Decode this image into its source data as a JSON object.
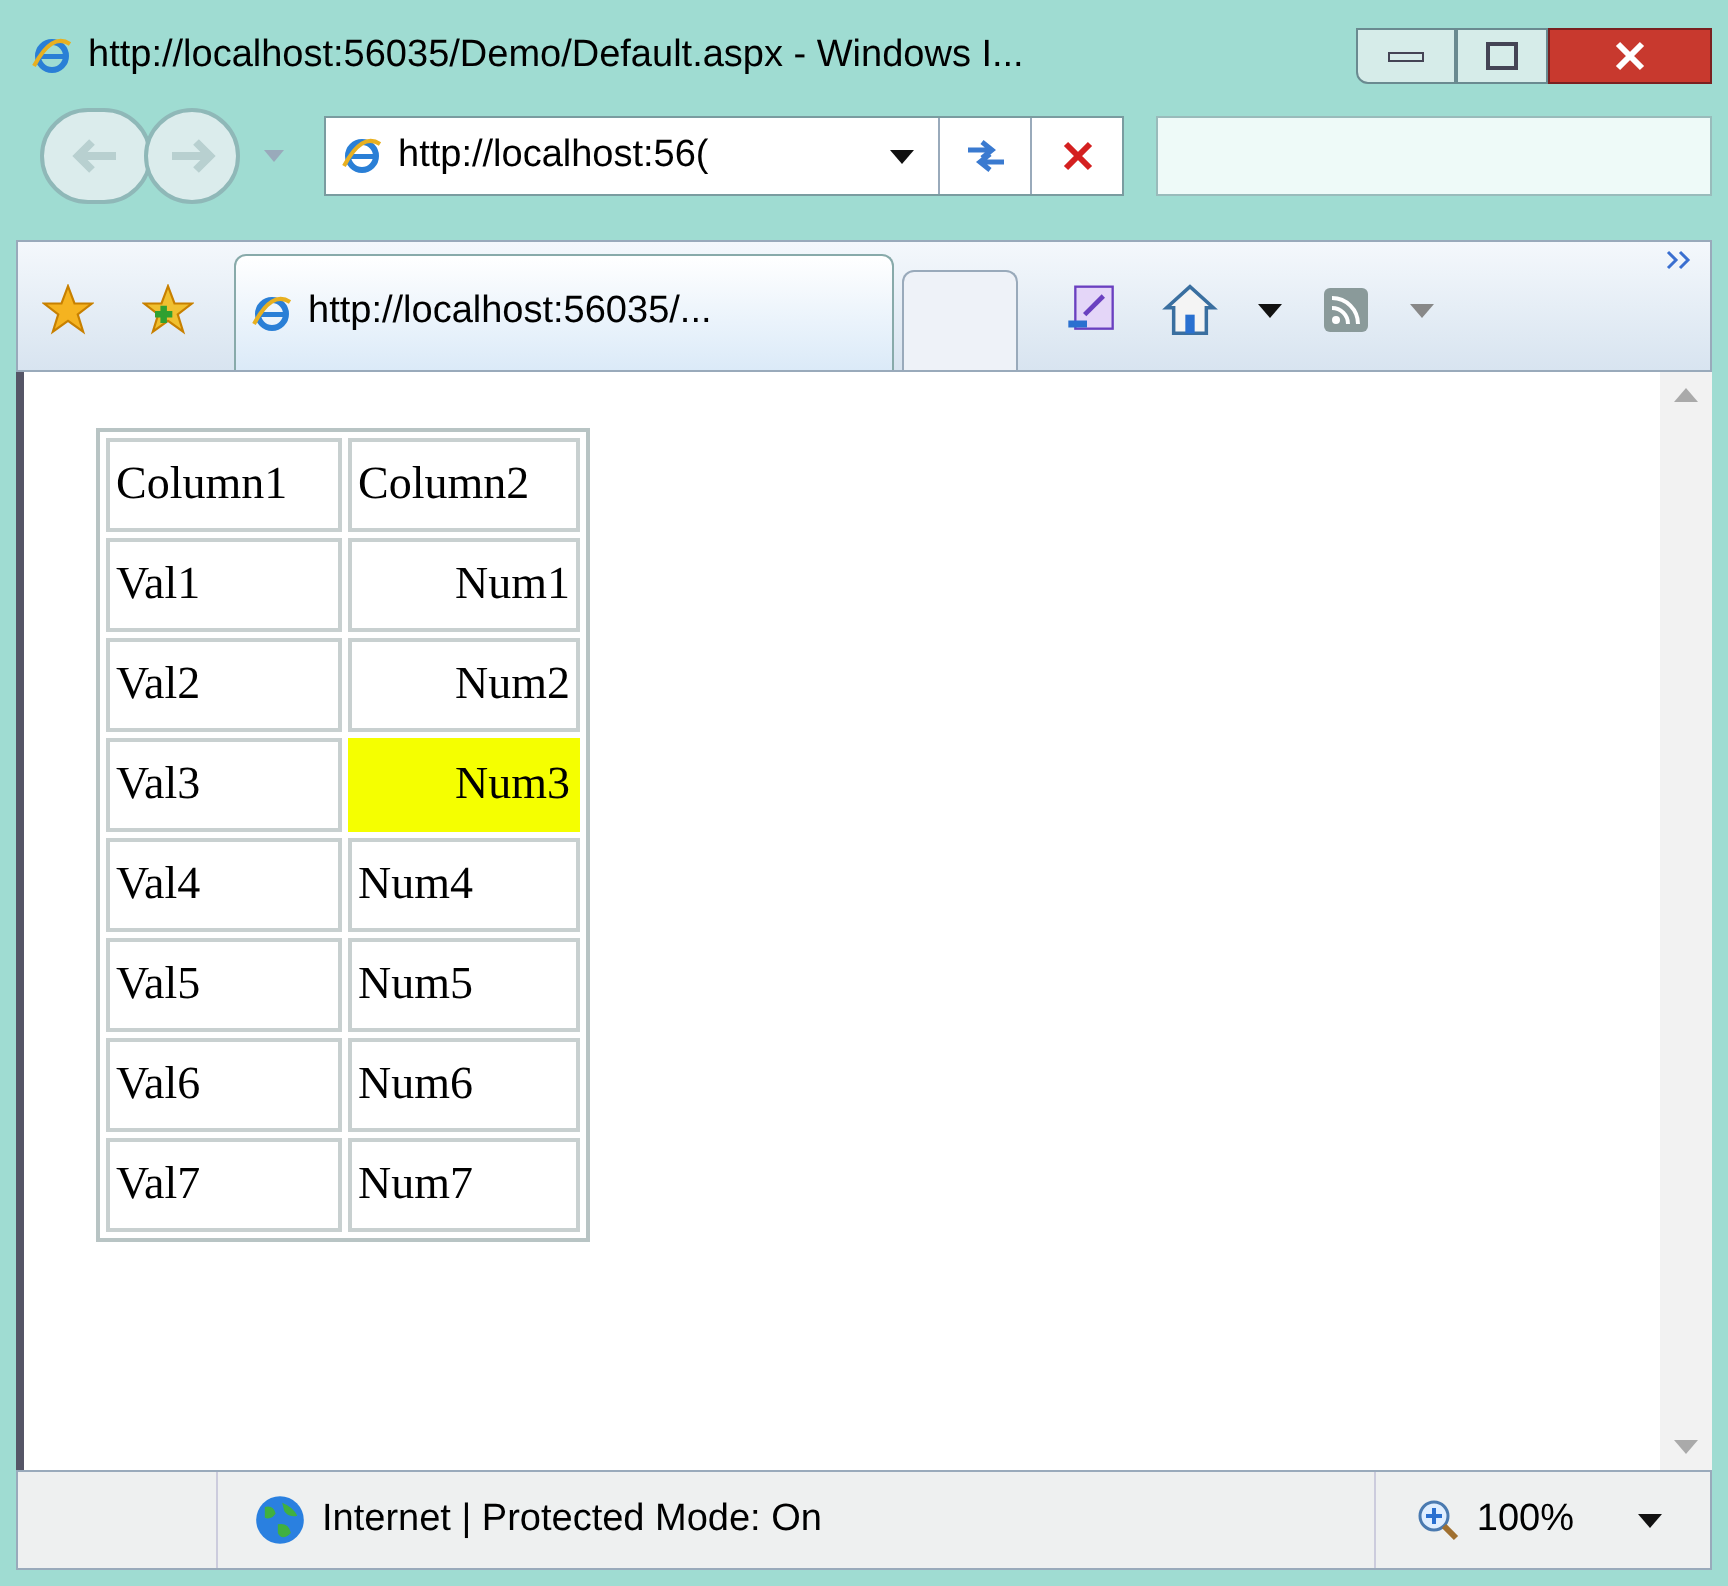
{
  "window": {
    "title": "http://localhost:56035/Demo/Default.aspx - Windows I..."
  },
  "address_bar": {
    "value": "http://localhost:56("
  },
  "tab": {
    "label": "http://localhost:56035/...",
    "selected": true
  },
  "table": {
    "columns": [
      "Column1",
      "Column2"
    ],
    "rows": [
      {
        "cells": [
          "Val1",
          "Num1"
        ],
        "right_aligned": true,
        "highlighted": false
      },
      {
        "cells": [
          "Val2",
          "Num2"
        ],
        "right_aligned": true,
        "highlighted": false
      },
      {
        "cells": [
          "Val3",
          "Num3"
        ],
        "right_aligned": true,
        "highlighted": true
      },
      {
        "cells": [
          "Val4",
          "Num4"
        ],
        "right_aligned": false,
        "highlighted": false
      },
      {
        "cells": [
          "Val5",
          "Num5"
        ],
        "right_aligned": false,
        "highlighted": false
      },
      {
        "cells": [
          "Val6",
          "Num6"
        ],
        "right_aligned": false,
        "highlighted": false
      },
      {
        "cells": [
          "Val7",
          "Num7"
        ],
        "right_aligned": false,
        "highlighted": false
      }
    ]
  },
  "status_bar": {
    "zone": "Internet | Protected Mode: On",
    "zoom": "100%"
  }
}
